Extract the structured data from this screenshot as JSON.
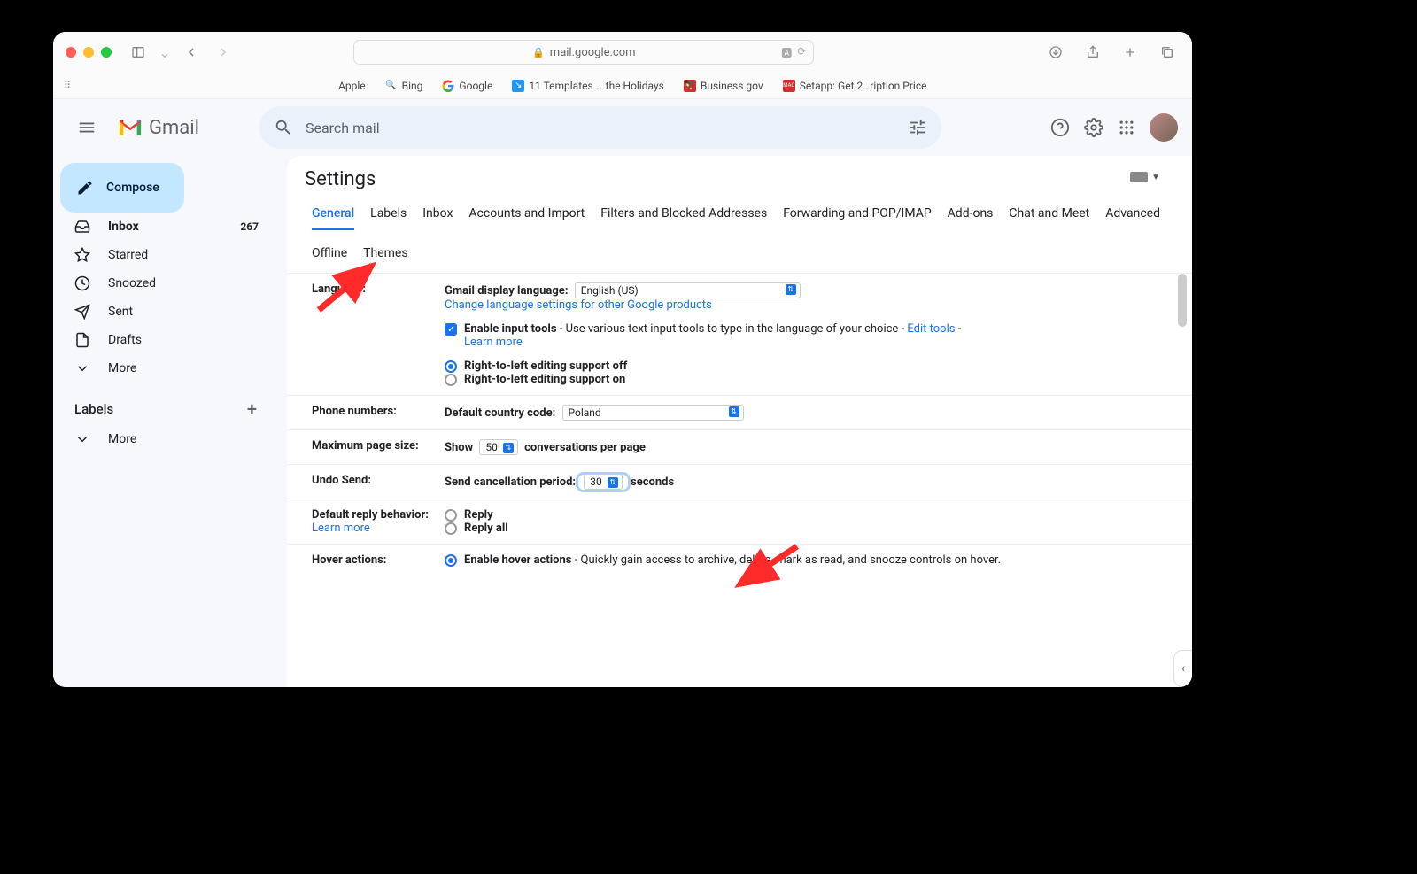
{
  "browser": {
    "url": "mail.google.com",
    "bookmarks": [
      "Apple",
      "Bing",
      "Google",
      "11 Templates … the Holidays",
      "Business gov",
      "Setapp: Get 2…ription Price"
    ]
  },
  "app": {
    "name": "Gmail",
    "compose": "Compose",
    "search_placeholder": "Search mail",
    "nav": {
      "inbox": "Inbox",
      "inbox_count": "267",
      "starred": "Starred",
      "snoozed": "Snoozed",
      "sent": "Sent",
      "drafts": "Drafts",
      "more": "More"
    },
    "labels_header": "Labels",
    "labels_more": "More"
  },
  "settings": {
    "title": "Settings",
    "tabs": [
      "General",
      "Labels",
      "Inbox",
      "Accounts and Import",
      "Filters and Blocked Addresses",
      "Forwarding and POP/IMAP",
      "Add-ons",
      "Chat and Meet",
      "Advanced",
      "Offline",
      "Themes"
    ],
    "language": {
      "label": "Language:",
      "display_label": "Gmail display language:",
      "display_value": "English (US)",
      "change_link": "Change language settings for other Google products",
      "enable_input": "Enable input tools",
      "enable_input_desc": " - Use various text input tools to type in the language of your choice - ",
      "edit_tools": "Edit tools",
      "learn_more": "Learn more",
      "rtl_off": "Right-to-left editing support off",
      "rtl_on": "Right-to-left editing support on"
    },
    "phone": {
      "label": "Phone numbers:",
      "cc_label": "Default country code:",
      "cc_value": "Poland"
    },
    "page_size": {
      "label": "Maximum page size:",
      "show": "Show",
      "value": "50",
      "suffix": "conversations per page"
    },
    "undo": {
      "label": "Undo Send:",
      "prefix": "Send cancellation period:",
      "value": "30",
      "suffix": "seconds"
    },
    "reply": {
      "label": "Default reply behavior:",
      "learn_more": "Learn more",
      "reply": "Reply",
      "reply_all": "Reply all"
    },
    "hover": {
      "label": "Hover actions:",
      "enable": "Enable hover actions",
      "desc": " - Quickly gain access to archive, delete, mark as read, and snooze controls on hover."
    }
  }
}
